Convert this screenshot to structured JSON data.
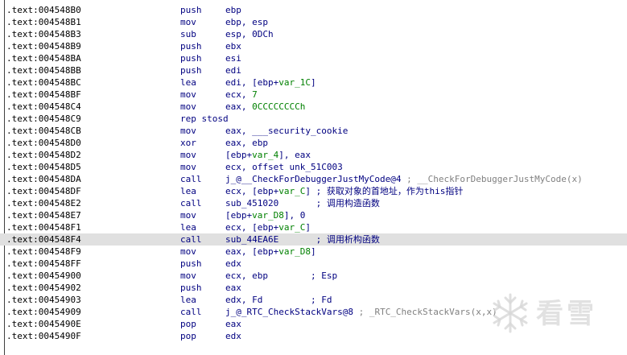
{
  "rows": [
    {
      "addr": ".text:004548B0",
      "mnemonic": "push",
      "operands": [
        {
          "text": "ebp"
        }
      ]
    },
    {
      "addr": ".text:004548B1",
      "mnemonic": "mov",
      "operands": [
        {
          "text": "ebp, esp"
        }
      ]
    },
    {
      "addr": ".text:004548B3",
      "mnemonic": "sub",
      "operands": [
        {
          "text": "esp, 0DCh"
        }
      ]
    },
    {
      "addr": ".text:004548B9",
      "mnemonic": "push",
      "operands": [
        {
          "text": "ebx"
        }
      ]
    },
    {
      "addr": ".text:004548BA",
      "mnemonic": "push",
      "operands": [
        {
          "text": "esi"
        }
      ]
    },
    {
      "addr": ".text:004548BB",
      "mnemonic": "push",
      "operands": [
        {
          "text": "edi"
        }
      ]
    },
    {
      "addr": ".text:004548BC",
      "mnemonic": "lea",
      "operands": [
        {
          "text": "edi, [ebp+"
        },
        {
          "text": "var_1C",
          "kind": "var"
        },
        {
          "text": "]"
        }
      ]
    },
    {
      "addr": ".text:004548BF",
      "mnemonic": "mov",
      "operands": [
        {
          "text": "ecx, "
        },
        {
          "text": "7",
          "kind": "var"
        }
      ]
    },
    {
      "addr": ".text:004548C4",
      "mnemonic": "mov",
      "operands": [
        {
          "text": "eax, "
        },
        {
          "text": "0CCCCCCCCh",
          "kind": "var"
        }
      ]
    },
    {
      "addr": ".text:004548C9",
      "wide": "rep stosd"
    },
    {
      "addr": ".text:004548CB",
      "mnemonic": "mov",
      "operands": [
        {
          "text": "eax, ___security_cookie"
        }
      ]
    },
    {
      "addr": ".text:004548D0",
      "mnemonic": "xor",
      "operands": [
        {
          "text": "eax, ebp"
        }
      ]
    },
    {
      "addr": ".text:004548D2",
      "mnemonic": "mov",
      "operands": [
        {
          "text": "[ebp+"
        },
        {
          "text": "var_4",
          "kind": "var"
        },
        {
          "text": "], eax"
        }
      ]
    },
    {
      "addr": ".text:004548D5",
      "mnemonic": "mov",
      "operands": [
        {
          "text": "ecx, offset unk_51C003"
        }
      ]
    },
    {
      "addr": ".text:004548DA",
      "mnemonic": "call",
      "operands": [
        {
          "text": "j_@__CheckForDebuggerJustMyCode@4"
        },
        {
          "text": " ; __CheckForDebuggerJustMyCode(x)",
          "kind": "cmt-gray"
        }
      ]
    },
    {
      "addr": ".text:004548DF",
      "mnemonic": "lea",
      "operands": [
        {
          "text": "ecx, [ebp+"
        },
        {
          "text": "var_C",
          "kind": "var"
        },
        {
          "text": "]"
        },
        {
          "text": " ; 获取对象的首地址，作为this指针",
          "kind": "cmt"
        }
      ]
    },
    {
      "addr": ".text:004548E2",
      "mnemonic": "call",
      "operands": [
        {
          "text": "sub_451020"
        },
        {
          "text": "       ; 调用构造函数",
          "kind": "cmt"
        }
      ]
    },
    {
      "addr": ".text:004548E7",
      "mnemonic": "mov",
      "operands": [
        {
          "text": "[ebp+"
        },
        {
          "text": "var_D8",
          "kind": "var"
        },
        {
          "text": "], 0"
        }
      ]
    },
    {
      "addr": ".text:004548F1",
      "mnemonic": "lea",
      "operands": [
        {
          "text": "ecx, [ebp+"
        },
        {
          "text": "var_C",
          "kind": "var"
        },
        {
          "text": "]"
        }
      ]
    },
    {
      "addr": ".text:004548F4",
      "mnemonic": "call",
      "operands": [
        {
          "text": "sub_44EA6E"
        },
        {
          "text": "       ; 调用析构函数",
          "kind": "cmt"
        }
      ],
      "selected": true
    },
    {
      "addr": ".text:004548F9",
      "mnemonic": "mov",
      "operands": [
        {
          "text": "eax, [ebp+"
        },
        {
          "text": "var_D8",
          "kind": "var"
        },
        {
          "text": "]"
        }
      ]
    },
    {
      "addr": ".text:004548FF",
      "mnemonic": "push",
      "operands": [
        {
          "text": "edx"
        }
      ]
    },
    {
      "addr": ".text:00454900",
      "mnemonic": "mov",
      "operands": [
        {
          "text": "ecx, ebp"
        },
        {
          "text": "        ; Esp",
          "kind": "cmt"
        }
      ]
    },
    {
      "addr": ".text:00454902",
      "mnemonic": "push",
      "operands": [
        {
          "text": "eax"
        }
      ]
    },
    {
      "addr": ".text:00454903",
      "mnemonic": "lea",
      "operands": [
        {
          "text": "edx, Fd"
        },
        {
          "text": "         ; Fd",
          "kind": "cmt"
        }
      ]
    },
    {
      "addr": ".text:00454909",
      "mnemonic": "call",
      "operands": [
        {
          "text": "j_@_RTC_CheckStackVars@8"
        },
        {
          "text": " ; _RTC_CheckStackVars(x,x)",
          "kind": "cmt-gray"
        }
      ]
    },
    {
      "addr": ".text:0045490E",
      "mnemonic": "pop",
      "operands": [
        {
          "text": "eax"
        }
      ]
    },
    {
      "addr": ".text:0045490F",
      "mnemonic": "pop",
      "operands": [
        {
          "text": "edx"
        }
      ]
    }
  ],
  "watermark": {
    "text": "看雪",
    "icon": "snowflake-icon"
  },
  "colors": {
    "address": "#000000",
    "instruction": "#000080",
    "variable": "#008000",
    "comment_gray": "#808080",
    "selected_row": "#e0e0e0"
  }
}
